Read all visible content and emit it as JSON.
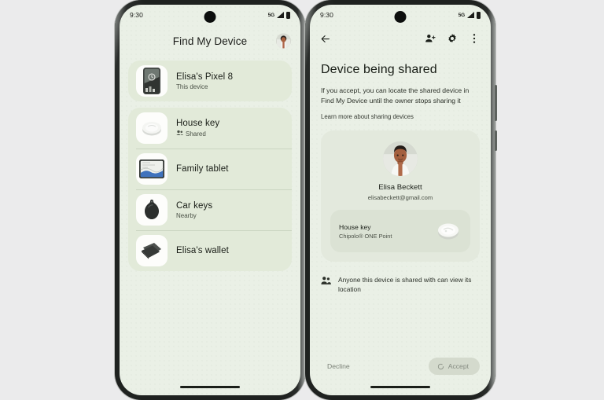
{
  "background_color": "#ebebec",
  "screen_color": "#eaf0e6",
  "accent_card_color": "#e2ead9",
  "phones": {
    "left": {
      "status": {
        "time": "9:30",
        "network": "5G",
        "signal_icon": "signal-bars-icon",
        "battery_icon": "battery-icon"
      },
      "appbar": {
        "title": "Find My Device",
        "avatar_icon": "user-avatar"
      },
      "devices": [
        {
          "title": "Elisa's Pixel 8",
          "subtitle": "This device",
          "subtitle_icon": null,
          "thumb_icon": "phone-thumbnail"
        },
        {
          "title": "House key",
          "subtitle": "Shared",
          "subtitle_icon": "people-icon",
          "thumb_icon": "chipolo-tracker-thumbnail"
        },
        {
          "title": "Family tablet",
          "subtitle": "",
          "subtitle_icon": null,
          "thumb_icon": "tablet-thumbnail"
        },
        {
          "title": "Car keys",
          "subtitle": "Nearby",
          "subtitle_icon": null,
          "thumb_icon": "tag-tracker-thumbnail"
        },
        {
          "title": "Elisa's wallet",
          "subtitle": "",
          "subtitle_icon": null,
          "thumb_icon": "wallet-thumbnail"
        }
      ]
    },
    "right": {
      "status": {
        "time": "9:30",
        "network": "5G",
        "signal_icon": "signal-bars-icon",
        "battery_icon": "battery-icon"
      },
      "appbar": {
        "back_icon": "arrow-back-icon",
        "add_person_icon": "person-add-icon",
        "settings_icon": "gear-icon",
        "overflow_icon": "more-vert-icon"
      },
      "headline": "Device being shared",
      "body": "If you accept, you can locate the shared device in Find My Device until the owner stops sharing it",
      "learn_more": "Learn more about sharing devices",
      "share_card": {
        "avatar_icon": "user-avatar-large",
        "name": "Elisa Beckett",
        "email": "elisabeckett@gmail.com",
        "device": {
          "title": "House key",
          "subtitle": "Chipolo® ONE Point",
          "art_icon": "chipolo-tracker-art"
        }
      },
      "notice": {
        "icon": "people-outline-icon",
        "text": "Anyone this device is shared with can view its location"
      },
      "actions": {
        "decline_label": "Decline",
        "accept_label": "Accept",
        "accept_icon": "loading-spinner-icon"
      }
    }
  }
}
